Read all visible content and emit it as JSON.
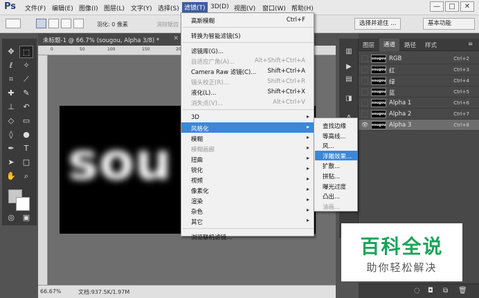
{
  "app": {
    "logo": "Ps"
  },
  "menubar": {
    "items": [
      "文件(F)",
      "编辑(E)",
      "图像(I)",
      "图层(L)",
      "文字(Y)",
      "选择(S)",
      "滤镜(T)",
      "3D(D)",
      "视图(V)",
      "窗口(W)",
      "帮助(H)"
    ],
    "active_index": 6
  },
  "window_controls": {
    "minimize": "—",
    "restore": "□",
    "close": "✕"
  },
  "options": {
    "feather_label": "羽化: 0 像素",
    "antialias_label": "消除锯齿",
    "select_mask_button": "选择并遮住 ...",
    "workspace": "基本功能"
  },
  "document": {
    "tab_title": "未标题-1 @ 66.7% (sougou, Alpha 3/8) *",
    "close_glyph": "✕",
    "canvas_text": "sou",
    "ruler_ticks": [
      "0",
      "50",
      "100",
      "150",
      "200",
      "250",
      "300",
      "350"
    ],
    "zoom": "66.67%",
    "doc_info": "文档:937.5K/1.97M"
  },
  "filter_menu": {
    "items": [
      {
        "label": "高斯模糊",
        "shortcut": "Ctrl+F",
        "disabled": false,
        "submenu": false,
        "highlight": false
      },
      {
        "sep": true
      },
      {
        "label": "转换为智能滤镜(S)",
        "shortcut": "",
        "disabled": false,
        "submenu": false,
        "highlight": false
      },
      {
        "sep": true
      },
      {
        "label": "滤镜库(G)...",
        "shortcut": "",
        "disabled": false,
        "submenu": false,
        "highlight": false
      },
      {
        "label": "自适应广角(A)...",
        "shortcut": "Alt+Shift+Ctrl+A",
        "disabled": true,
        "submenu": false,
        "highlight": false
      },
      {
        "label": "Camera Raw 滤镜(C)...",
        "shortcut": "Shift+Ctrl+A",
        "disabled": false,
        "submenu": false,
        "highlight": false
      },
      {
        "label": "镜头校正(R)...",
        "shortcut": "Shift+Ctrl+R",
        "disabled": true,
        "submenu": false,
        "highlight": false
      },
      {
        "label": "液化(L)...",
        "shortcut": "Shift+Ctrl+X",
        "disabled": false,
        "submenu": false,
        "highlight": false
      },
      {
        "label": "消失点(V)...",
        "shortcut": "Alt+Ctrl+V",
        "disabled": true,
        "submenu": false,
        "highlight": false
      },
      {
        "sep": true
      },
      {
        "label": "3D",
        "shortcut": "",
        "disabled": false,
        "submenu": true,
        "highlight": false
      },
      {
        "label": "风格化",
        "shortcut": "",
        "disabled": false,
        "submenu": true,
        "highlight": true
      },
      {
        "label": "模糊",
        "shortcut": "",
        "disabled": false,
        "submenu": true,
        "highlight": false
      },
      {
        "label": "模糊画廊",
        "shortcut": "",
        "disabled": true,
        "submenu": true,
        "highlight": false
      },
      {
        "label": "扭曲",
        "shortcut": "",
        "disabled": false,
        "submenu": true,
        "highlight": false
      },
      {
        "label": "锐化",
        "shortcut": "",
        "disabled": false,
        "submenu": true,
        "highlight": false
      },
      {
        "label": "视频",
        "shortcut": "",
        "disabled": false,
        "submenu": true,
        "highlight": false
      },
      {
        "label": "像素化",
        "shortcut": "",
        "disabled": false,
        "submenu": true,
        "highlight": false
      },
      {
        "label": "渲染",
        "shortcut": "",
        "disabled": false,
        "submenu": true,
        "highlight": false
      },
      {
        "label": "杂色",
        "shortcut": "",
        "disabled": false,
        "submenu": true,
        "highlight": false
      },
      {
        "label": "其它",
        "shortcut": "",
        "disabled": false,
        "submenu": true,
        "highlight": false
      },
      {
        "sep": true
      },
      {
        "label": "浏览联机滤镜...",
        "shortcut": "",
        "disabled": false,
        "submenu": false,
        "highlight": false
      }
    ]
  },
  "stylize_submenu": {
    "items": [
      {
        "label": "查找边缘",
        "disabled": false,
        "highlight": false
      },
      {
        "label": "等高线...",
        "disabled": false,
        "highlight": false
      },
      {
        "label": "风...",
        "disabled": false,
        "highlight": false
      },
      {
        "label": "浮雕效果...",
        "disabled": false,
        "highlight": true
      },
      {
        "label": "扩散...",
        "disabled": false,
        "highlight": false
      },
      {
        "label": "拼贴...",
        "disabled": false,
        "highlight": false
      },
      {
        "label": "曝光过度",
        "disabled": false,
        "highlight": false
      },
      {
        "label": "凸出...",
        "disabled": false,
        "highlight": false
      },
      {
        "label": "油画...",
        "disabled": true,
        "highlight": false
      }
    ]
  },
  "channels_panel": {
    "tabs": [
      "图层",
      "通道",
      "路径",
      "样式"
    ],
    "active_tab": 1,
    "channels": [
      {
        "name": "RGB",
        "shortcut": "Ctrl+2",
        "thumb": "sougou",
        "selected": false,
        "visible": false
      },
      {
        "name": "红",
        "shortcut": "Ctrl+3",
        "thumb": "sougou",
        "selected": false,
        "visible": false
      },
      {
        "name": "绿",
        "shortcut": "Ctrl+4",
        "thumb": "sougou",
        "selected": false,
        "visible": false
      },
      {
        "name": "蓝",
        "shortcut": "Ctrl+5",
        "thumb": "sougou",
        "selected": false,
        "visible": false
      },
      {
        "name": "Alpha 1",
        "shortcut": "Ctrl+6",
        "thumb": "sougou",
        "selected": false,
        "visible": false
      },
      {
        "name": "Alpha 2",
        "shortcut": "Ctrl+7",
        "thumb": "sougou",
        "selected": false,
        "visible": false
      },
      {
        "name": "Alpha 3",
        "shortcut": "Ctrl+8",
        "thumb": "sougou",
        "selected": true,
        "visible": true
      }
    ]
  },
  "watermark": {
    "title": "百科全说",
    "subtitle": "助你轻松解决"
  },
  "colors": {
    "menu_highlight": "#3b87d9",
    "watermark_green": "#1aa55a"
  }
}
